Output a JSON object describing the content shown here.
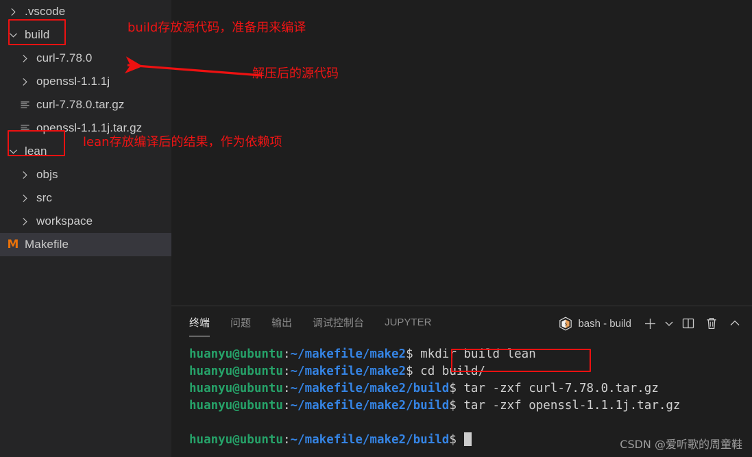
{
  "colors": {
    "sidebar_bg": "#252526",
    "editor_bg": "#1e1e1e",
    "annotation_red": "#f01414",
    "prompt_green": "#26a269",
    "prompt_blue": "#3584e4",
    "makefile_orange": "#e8710a",
    "selected_row": "#37373d"
  },
  "sidebar": {
    "items": [
      {
        "label": ".vscode",
        "icon": "chevron-right-icon",
        "kind": "folder-collapsed",
        "indent": 0,
        "selected": false
      },
      {
        "label": "build",
        "icon": "chevron-down-icon",
        "kind": "folder-expanded",
        "indent": 0,
        "selected": false
      },
      {
        "label": "curl-7.78.0",
        "icon": "chevron-right-icon",
        "kind": "folder-collapsed",
        "indent": 1,
        "selected": false
      },
      {
        "label": "openssl-1.1.1j",
        "icon": "chevron-right-icon",
        "kind": "folder-collapsed",
        "indent": 1,
        "selected": false
      },
      {
        "label": "curl-7.78.0.tar.gz",
        "icon": "archive-file-icon",
        "kind": "file",
        "indent": 1,
        "selected": false
      },
      {
        "label": "openssl-1.1.1j.tar.gz",
        "icon": "archive-file-icon",
        "kind": "file",
        "indent": 1,
        "selected": false
      },
      {
        "label": "lean",
        "icon": "chevron-down-icon",
        "kind": "folder-expanded",
        "indent": 0,
        "selected": false
      },
      {
        "label": "objs",
        "icon": "chevron-right-icon",
        "kind": "folder-collapsed",
        "indent": 1,
        "selected": false
      },
      {
        "label": "src",
        "icon": "chevron-right-icon",
        "kind": "folder-collapsed",
        "indent": 1,
        "selected": false
      },
      {
        "label": "workspace",
        "icon": "chevron-right-icon",
        "kind": "folder-collapsed",
        "indent": 1,
        "selected": false
      },
      {
        "label": "Makefile",
        "icon": "makefile-m-icon",
        "kind": "file",
        "indent": 0,
        "selected": true
      }
    ]
  },
  "annotations": [
    {
      "text": "build存放源代码，准备用来编译"
    },
    {
      "text": "解压后的源代码"
    },
    {
      "text": "lean存放编译后的结果，作为依赖项"
    }
  ],
  "panel": {
    "tabs": [
      {
        "label": "终端",
        "active": true
      },
      {
        "label": "问题",
        "active": false
      },
      {
        "label": "输出",
        "active": false
      },
      {
        "label": "调试控制台",
        "active": false
      },
      {
        "label": "JUPYTER",
        "active": false
      }
    ],
    "terminal_name": "bash - build",
    "actions": [
      {
        "name": "new-terminal-icon",
        "glyph": "+"
      },
      {
        "name": "chevron-down-icon",
        "glyph": "v"
      },
      {
        "name": "split-terminal-icon",
        "glyph": "split"
      },
      {
        "name": "kill-terminal-icon",
        "glyph": "trash"
      },
      {
        "name": "maximize-panel-icon",
        "glyph": "^"
      }
    ]
  },
  "terminal": {
    "lines": [
      {
        "user": "huanyu@ubuntu",
        "colon": ":",
        "path": "~/makefile/make2",
        "dollar": "$ ",
        "command": "mkdir build lean",
        "boxed": true
      },
      {
        "user": "huanyu@ubuntu",
        "colon": ":",
        "path": "~/makefile/make2",
        "dollar": "$ ",
        "command": "cd build/",
        "boxed": false
      },
      {
        "user": "huanyu@ubuntu",
        "colon": ":",
        "path": "~/makefile/make2/build",
        "dollar": "$ ",
        "command": "tar -zxf curl-7.78.0.tar.gz",
        "boxed": false
      },
      {
        "user": "huanyu@ubuntu",
        "colon": ":",
        "path": "~/makefile/make2/build",
        "dollar": "$ ",
        "command": "tar -zxf openssl-1.1.1j.tar.gz",
        "boxed": false
      },
      {
        "user": "",
        "colon": "",
        "path": "",
        "dollar": "",
        "command": "",
        "boxed": false
      },
      {
        "user": "huanyu@ubuntu",
        "colon": ":",
        "path": "~/makefile/make2/build",
        "dollar": "$ ",
        "command": "",
        "boxed": false,
        "cursor": true
      }
    ]
  },
  "watermark": {
    "text": "CSDN @爱听歌的周童鞋"
  }
}
